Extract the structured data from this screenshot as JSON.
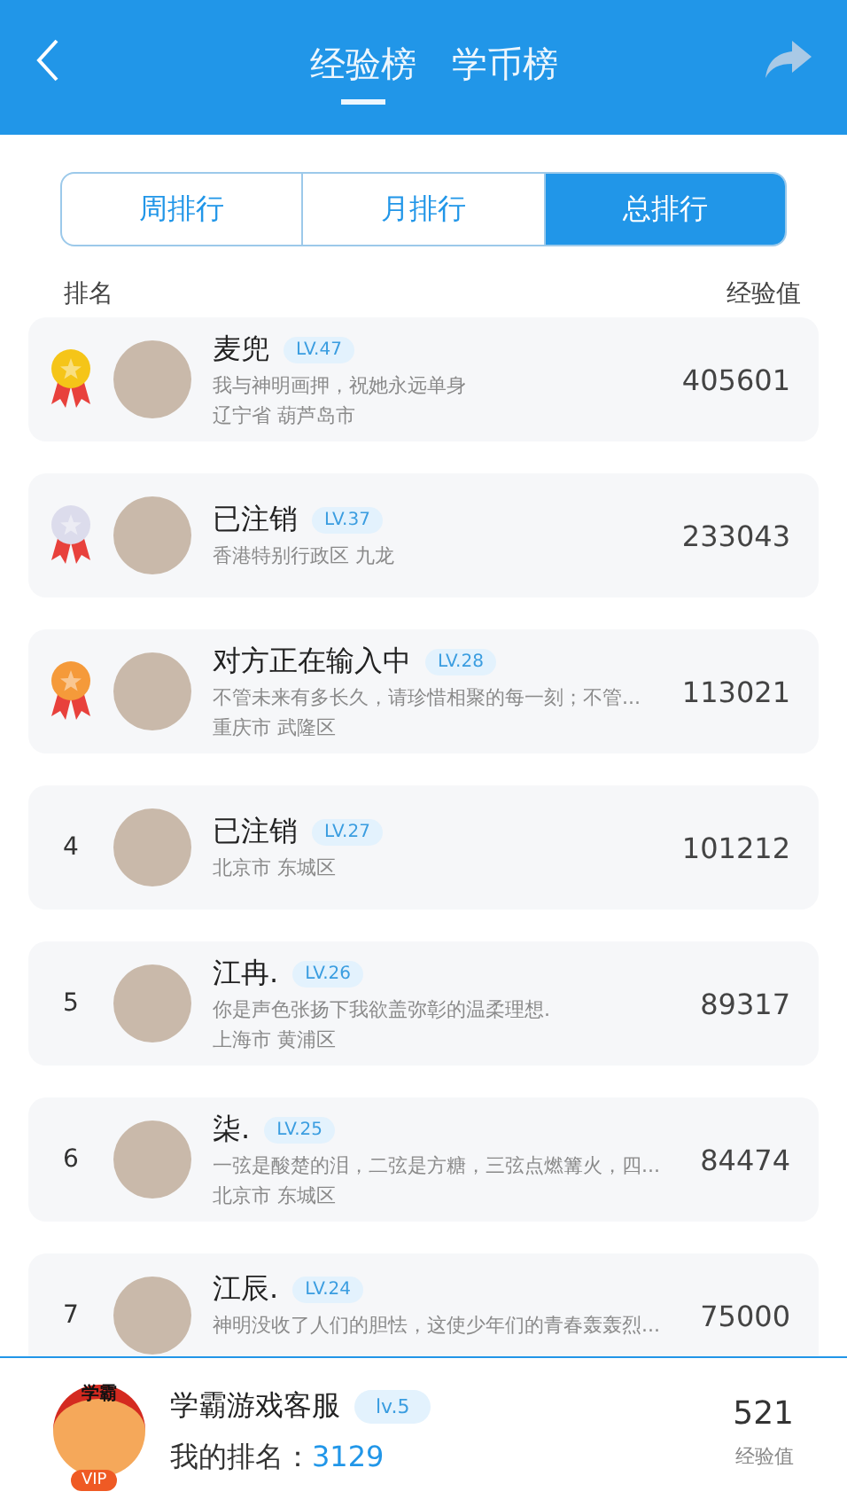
{
  "header": {
    "tabs": [
      {
        "label": "经验榜",
        "selected": true
      },
      {
        "label": "学币榜",
        "selected": false
      }
    ]
  },
  "period_tabs": [
    {
      "label": "周排行",
      "selected": false
    },
    {
      "label": "月排行",
      "selected": false
    },
    {
      "label": "总排行",
      "selected": true
    }
  ],
  "columns": {
    "rank": "排名",
    "score": "经验值"
  },
  "ranking": [
    {
      "kind": "medal",
      "color": "#f5c518",
      "name": "麦兜",
      "level": "LV.47",
      "motto": "我与神明画押，祝她永远单身",
      "location": "辽宁省 葫芦岛市",
      "score": "405601"
    },
    {
      "kind": "medal",
      "color": "#dcdcec",
      "name": "已注销",
      "level": "LV.37",
      "location": "香港特别行政区 九龙",
      "score": "233043"
    },
    {
      "kind": "medal",
      "color": "#f59a3a",
      "name": "对方正在输入中",
      "level": "LV.28",
      "motto": "不管未来有多长久，请珍惜相聚的每一刻；不管...",
      "location": "重庆市 武隆区",
      "score": "113021"
    },
    {
      "kind": "number",
      "rank": "4",
      "name": "已注销",
      "level": "LV.27",
      "location": "北京市 东城区",
      "score": "101212"
    },
    {
      "kind": "number",
      "rank": "5",
      "name": "江冉.",
      "level": "LV.26",
      "motto": "你是声色张扬下我欲盖弥彰的温柔理想.",
      "location": "上海市 黄浦区",
      "score": "89317"
    },
    {
      "kind": "number",
      "rank": "6",
      "name": "柒.",
      "level": "LV.25",
      "motto": "一弦是酸楚的泪，二弦是方糖，三弦点燃篝火，四...",
      "location": "北京市 东城区",
      "score": "84474"
    },
    {
      "kind": "number",
      "rank": "7",
      "name": "江辰.",
      "level": "LV.24",
      "motto": "神明没收了人们的胆怯，这使少年们的青春轰轰烈...",
      "score": "75000"
    }
  ],
  "me": {
    "avatar_band": "学霸",
    "avatar_badge": "VIP",
    "name": "学霸游戏客服",
    "level": "lv.5",
    "rank_label": "我的排名：",
    "rank": "3129",
    "score": "521",
    "score_label": "经验值"
  }
}
